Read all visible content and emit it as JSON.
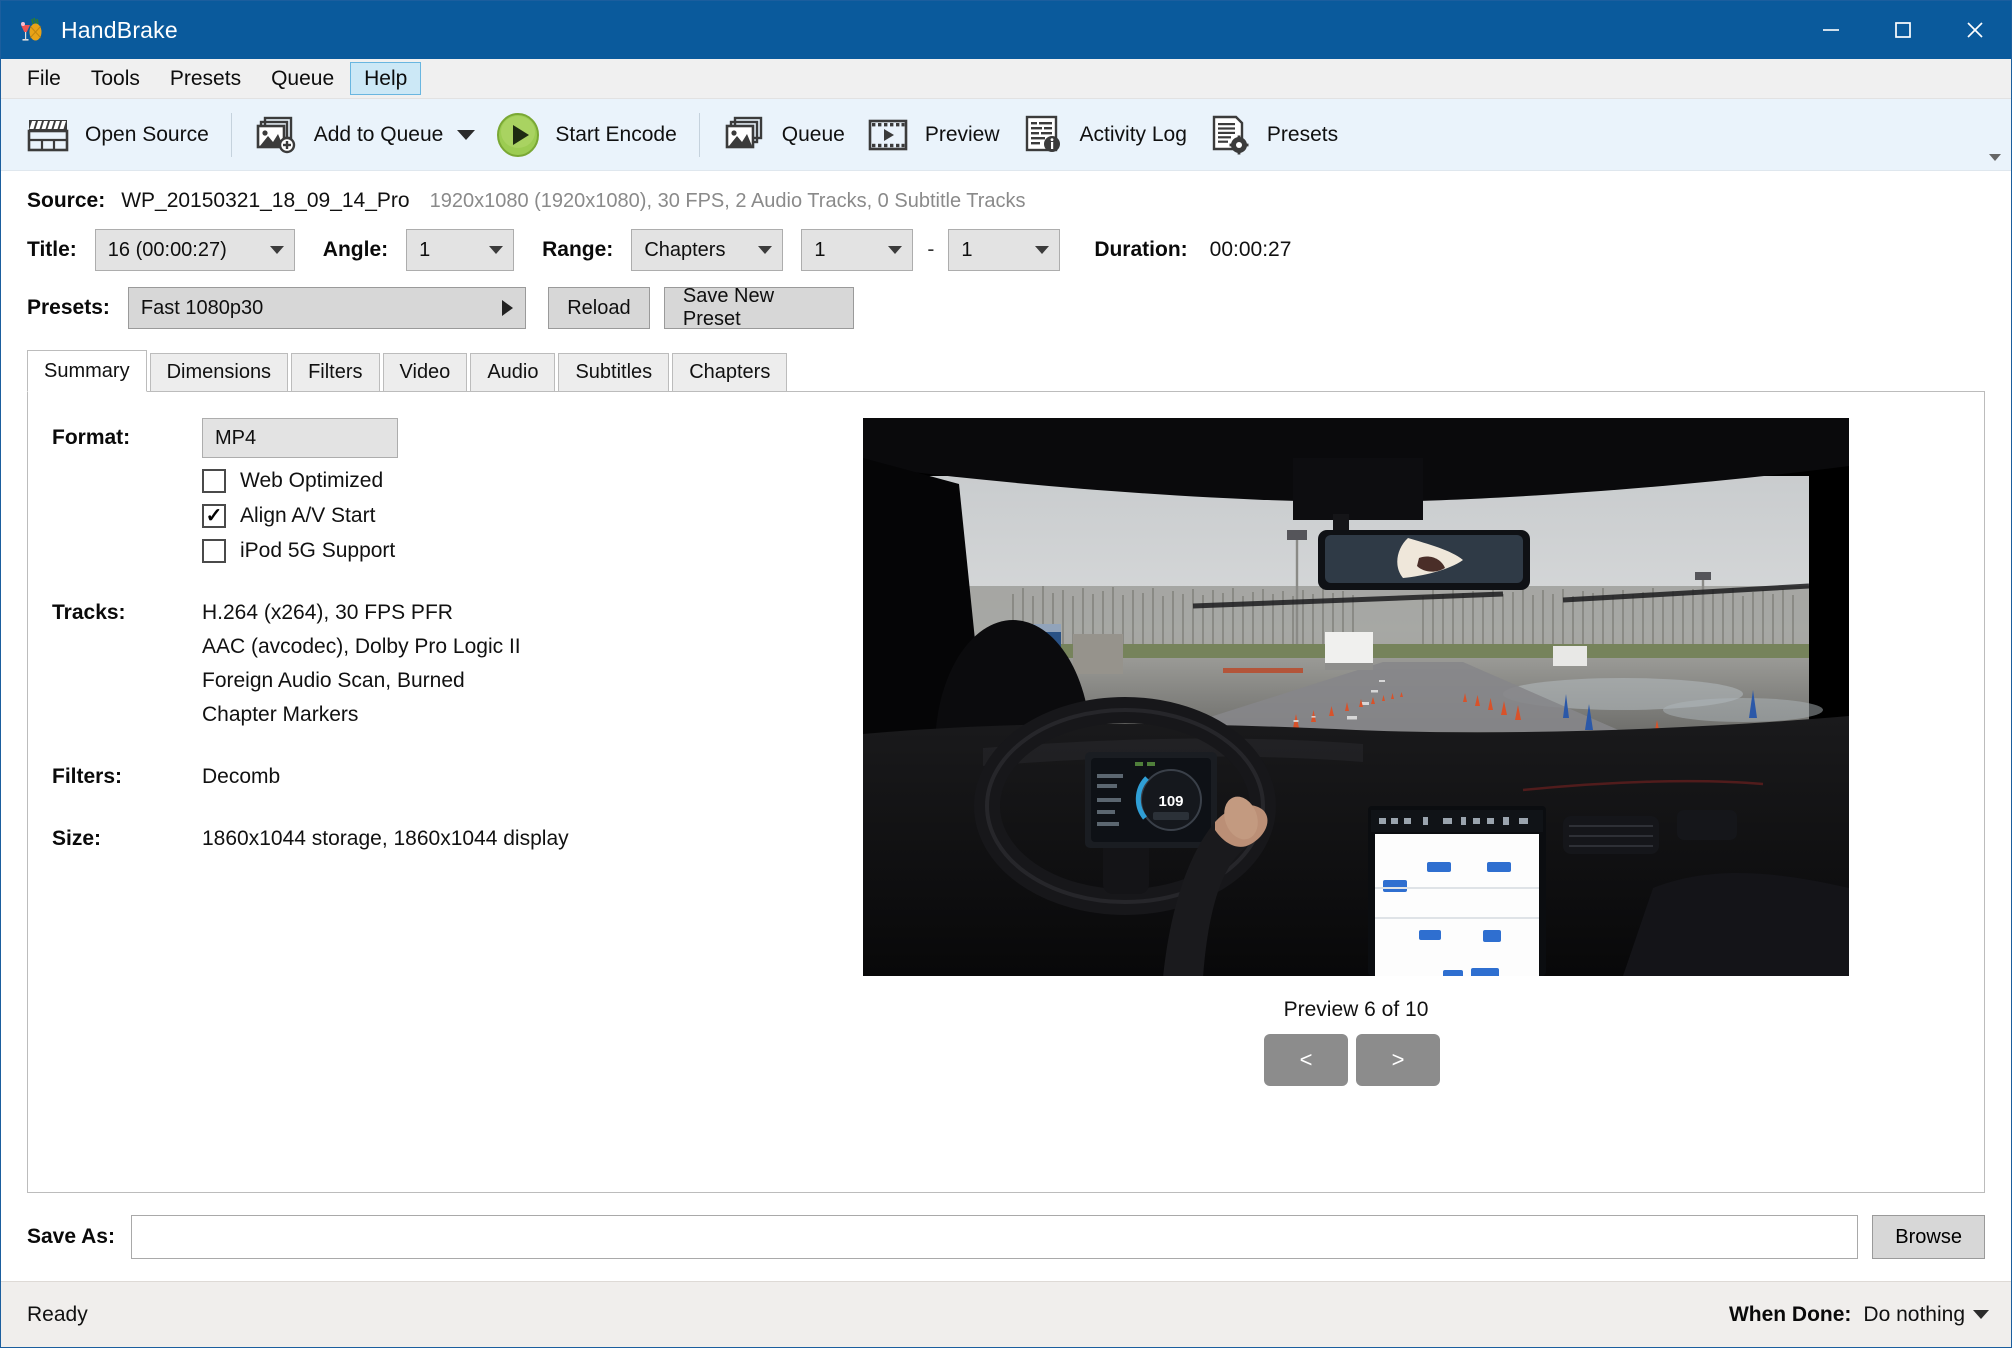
{
  "window": {
    "title": "HandBrake",
    "icon": "handbrake-pineapple-icon",
    "minimize": "minimize-icon",
    "maximize": "maximize-icon",
    "close": "close-icon",
    "titlebar_color": "#0a5a9c"
  },
  "menubar": {
    "items": [
      {
        "label": "File",
        "active": false
      },
      {
        "label": "Tools",
        "active": false
      },
      {
        "label": "Presets",
        "active": false
      },
      {
        "label": "Queue",
        "active": false
      },
      {
        "label": "Help",
        "active": true
      }
    ],
    "highlight_color": "#cce8f6"
  },
  "toolbar": {
    "background": "#eaf3fb",
    "buttons": [
      {
        "label": "Open Source",
        "icon": "clapperboard-icon",
        "dropdown": false
      },
      {
        "label": "Add to Queue",
        "icon": "add-to-queue-icon",
        "dropdown": true
      },
      {
        "label": "Start Encode",
        "icon": "play-circle-icon",
        "dropdown": false
      },
      {
        "label": "Queue",
        "icon": "queue-stack-icon",
        "dropdown": false
      },
      {
        "label": "Preview",
        "icon": "film-strip-play-icon",
        "dropdown": false
      },
      {
        "label": "Activity Log",
        "icon": "activity-log-icon",
        "dropdown": false
      },
      {
        "label": "Presets",
        "icon": "presets-gear-doc-icon",
        "dropdown": false
      }
    ],
    "accent_green": "#8cc63e"
  },
  "source": {
    "label": "Source:",
    "name": "WP_20150321_18_09_14_Pro",
    "meta": "1920x1080 (1920x1080), 30 FPS, 2 Audio Tracks, 0 Subtitle Tracks"
  },
  "title_row": {
    "title_label": "Title:",
    "title_value": "16 (00:00:27)",
    "angle_label": "Angle:",
    "angle_value": "1",
    "range_label": "Range:",
    "range_type": "Chapters",
    "range_start": "1",
    "range_separator": "-",
    "range_end": "1",
    "duration_label": "Duration:",
    "duration_value": "00:00:27"
  },
  "presets_row": {
    "label": "Presets:",
    "selected": "Fast 1080p30",
    "reload_label": "Reload",
    "save_label": "Save New Preset"
  },
  "tabs": [
    {
      "label": "Summary",
      "active": true
    },
    {
      "label": "Dimensions",
      "active": false
    },
    {
      "label": "Filters",
      "active": false
    },
    {
      "label": "Video",
      "active": false
    },
    {
      "label": "Audio",
      "active": false
    },
    {
      "label": "Subtitles",
      "active": false
    },
    {
      "label": "Chapters",
      "active": false
    }
  ],
  "summary": {
    "format_label": "Format:",
    "format_value": "MP4",
    "checkboxes": [
      {
        "label": "Web Optimized",
        "checked": false
      },
      {
        "label": "Align A/V Start",
        "checked": true
      },
      {
        "label": "iPod 5G Support",
        "checked": false
      }
    ],
    "tracks_label": "Tracks:",
    "tracks": [
      "H.264 (x264), 30 FPS PFR",
      "AAC (avcodec), Dolby Pro Logic II",
      "Foreign Audio Scan, Burned",
      "Chapter Markers"
    ],
    "filters_label": "Filters:",
    "filters_value": "Decomb",
    "size_label": "Size:",
    "size_value": "1860x1044 storage, 1860x1044 display"
  },
  "preview": {
    "caption": "Preview 6 of 10",
    "prev_label": "<",
    "next_label": ">",
    "image_description": "Driver POV inside a Tesla on a wet test track with traffic cones, hand on steering wheel, center touchscreen showing map, speed 109"
  },
  "save_as": {
    "label": "Save As:",
    "value": "",
    "placeholder": "",
    "browse_label": "Browse"
  },
  "statusbar": {
    "status": "Ready",
    "when_done_label": "When Done:",
    "when_done_value": "Do nothing"
  }
}
